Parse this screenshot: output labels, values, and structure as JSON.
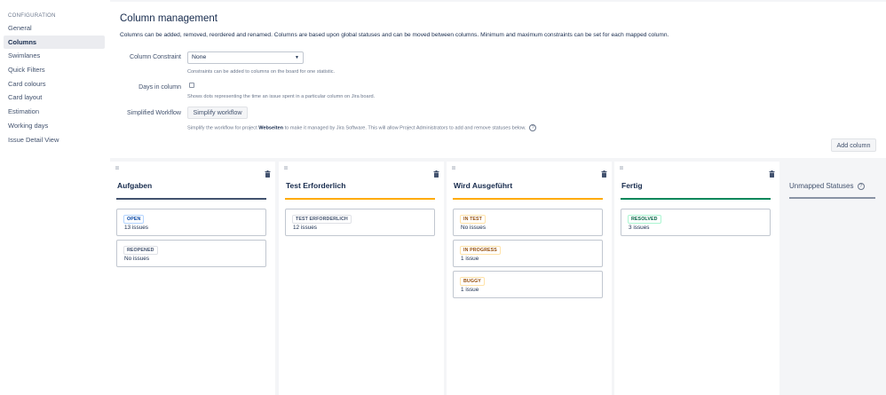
{
  "sidebar": {
    "section_label": "CONFIGURATION",
    "items": [
      {
        "label": "General"
      },
      {
        "label": "Columns"
      },
      {
        "label": "Swimlanes"
      },
      {
        "label": "Quick Filters"
      },
      {
        "label": "Card colours"
      },
      {
        "label": "Card layout"
      },
      {
        "label": "Estimation"
      },
      {
        "label": "Working days"
      },
      {
        "label": "Issue Detail View"
      }
    ],
    "active_item": "Columns"
  },
  "header": {
    "title": "Column management",
    "description": "Columns can be added, removed, reordered and renamed. Columns are based upon global statuses and can be moved between columns. Minimum and maximum constraints can be set for each mapped column."
  },
  "form": {
    "constraint": {
      "label": "Column Constraint",
      "value": "None",
      "help": "Constraints can be added to columns on the board for one statistic."
    },
    "days_in_column": {
      "label": "Days in column",
      "checked": false,
      "help": "Shows dots representing the time an issue spent in a particular column on Jira board."
    },
    "simplified_workflow": {
      "label": "Simplified Workflow",
      "button_label": "Simplify workflow",
      "help_prefix": "Simplify the workflow for project ",
      "help_project": "Webseiten",
      "help_suffix": " to make it managed by Jira Software. This will allow Project Administrators to add and remove statuses below."
    },
    "add_column_label": "Add column"
  },
  "columns": [
    {
      "title": "Aufgaben",
      "bar_color": "#42526e",
      "statuses": [
        {
          "name": "OPEN",
          "count": "13 issues",
          "category": "blue"
        },
        {
          "name": "REOPENED",
          "count": "No issues",
          "category": "grey"
        }
      ]
    },
    {
      "title": "Test Erforderlich",
      "bar_color": "#ffab00",
      "statuses": [
        {
          "name": "TEST ERFORDERLICH",
          "count": "12 issues",
          "category": "grey"
        }
      ]
    },
    {
      "title": "Wird Ausgeführt",
      "bar_color": "#ffab00",
      "statuses": [
        {
          "name": "IN TEST",
          "count": "No issues",
          "category": "yellow"
        },
        {
          "name": "IN PROGRESS",
          "count": "1 issue",
          "category": "yellow"
        },
        {
          "name": "BUGGY",
          "count": "1 issue",
          "category": "yellow"
        }
      ]
    },
    {
      "title": "Fertig",
      "bar_color": "#00875a",
      "statuses": [
        {
          "name": "RESOLVED",
          "count": "3 issues",
          "category": "green"
        }
      ]
    }
  ],
  "unmapped": {
    "title": "Unmapped Statuses"
  },
  "icons": {
    "grip": "drag-handle-icon",
    "trash": "trash-icon",
    "help": "help-icon",
    "caret": "chevron-down-icon"
  }
}
